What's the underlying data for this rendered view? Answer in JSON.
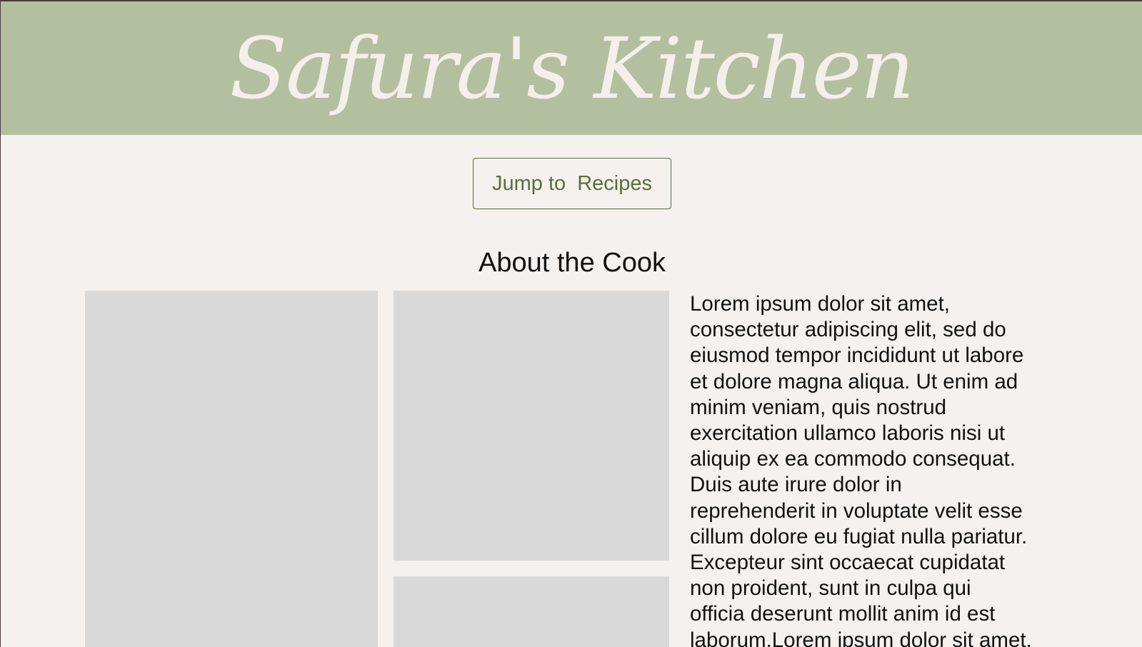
{
  "header": {
    "title": "Safura's Kitchen",
    "background_color": "#b4bfa0",
    "title_color": "#f3efe9"
  },
  "navigation": {
    "jump_button_label": "Jump to  Recipes",
    "accent_color": "#5c6e37"
  },
  "about": {
    "heading": "About the Cook",
    "bio_lines": [
      "Lorem ipsum dolor sit amet,",
      "consectetur adipiscing elit, sed do",
      "eiusmod tempor incididunt ut labore",
      "et dolore magna aliqua. Ut enim ad",
      "minim veniam, quis nostrud",
      "exercitation ullamco laboris nisi ut",
      "aliquip ex ea commodo consequat.",
      "Duis aute irure dolor in",
      "reprehenderit in voluptate velit esse",
      "cillum dolore eu fugiat nulla pariatur.",
      "Excepteur sint occaecat cupidatat",
      "non proident, sunt in culpa qui",
      "officia deserunt mollit anim id est",
      "laborum.Lorem ipsum dolor sit amet,"
    ]
  }
}
